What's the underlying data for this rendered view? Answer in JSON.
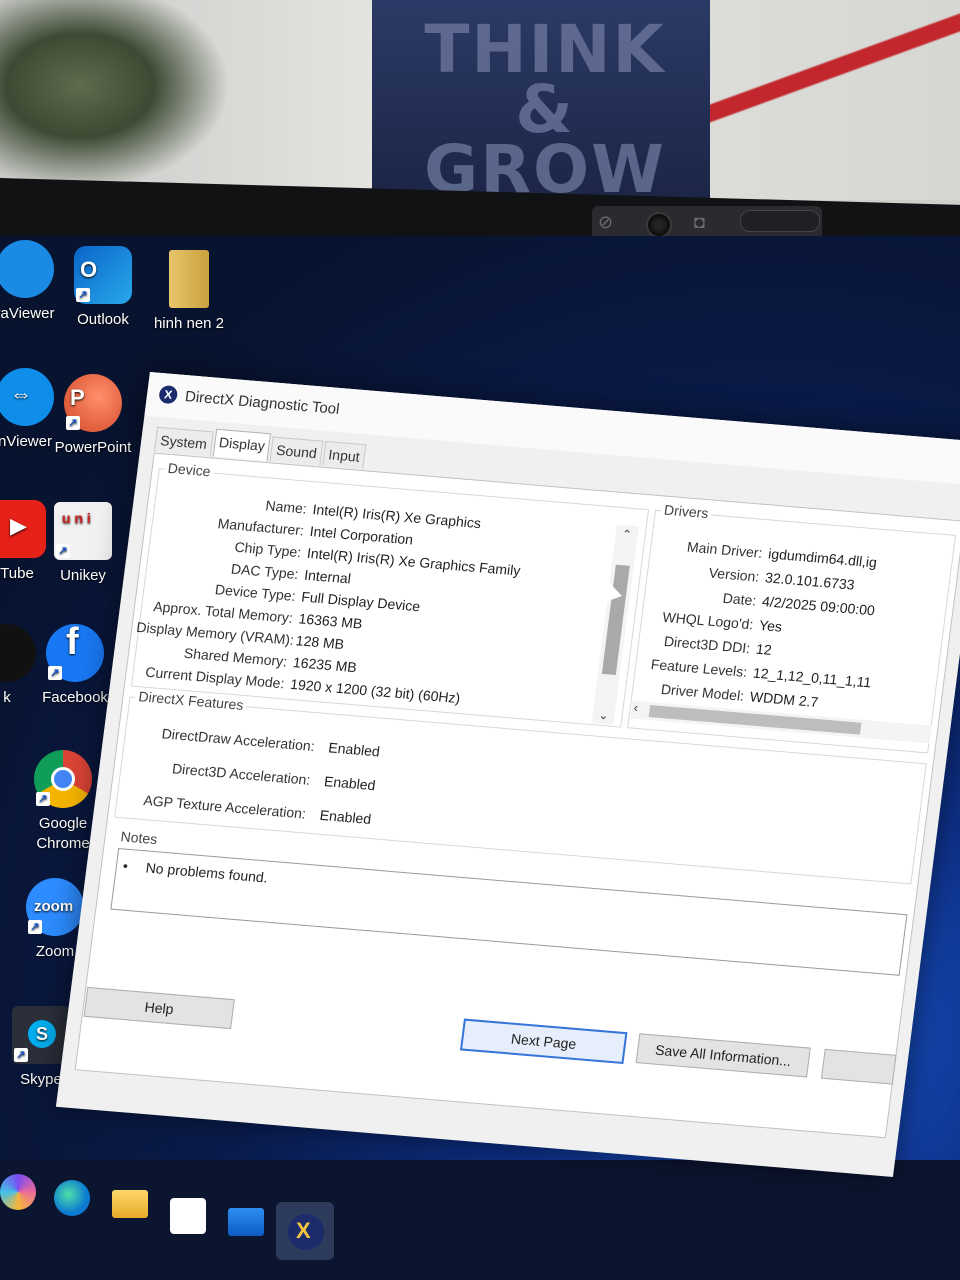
{
  "photo": {
    "poster_text": "THINK & GROW RICH"
  },
  "desktop": {
    "icons": [
      {
        "label": "raViewer"
      },
      {
        "label": "Outlook"
      },
      {
        "label": "hinh nen 2"
      },
      {
        "label": "nViewer"
      },
      {
        "label": "PowerPoint"
      },
      {
        "label": "Tube"
      },
      {
        "label": "Unikey"
      },
      {
        "label": "k"
      },
      {
        "label": "Facebook"
      },
      {
        "label": "Google Chrome"
      },
      {
        "label": "Zoom"
      },
      {
        "label": "Skype"
      }
    ],
    "zoom_logo_text": "zoom"
  },
  "dialog": {
    "title": "DirectX Diagnostic Tool",
    "tabs": [
      "System",
      "Display",
      "Sound",
      "Input"
    ],
    "active_tab": "Display",
    "device": {
      "group_label": "Device",
      "rows": [
        {
          "k": "Name:",
          "v": "Intel(R) Iris(R) Xe Graphics"
        },
        {
          "k": "Manufacturer:",
          "v": "Intel Corporation"
        },
        {
          "k": "Chip Type:",
          "v": "Intel(R) Iris(R) Xe Graphics Family"
        },
        {
          "k": "DAC Type:",
          "v": "Internal"
        },
        {
          "k": "Device Type:",
          "v": "Full Display Device"
        },
        {
          "k": "Approx. Total Memory:",
          "v": "16363 MB"
        },
        {
          "k": "Display Memory (VRAM):",
          "v": "128 MB"
        },
        {
          "k": "Shared Memory:",
          "v": "16235 MB"
        },
        {
          "k": "Current Display Mode:",
          "v": "1920 x 1200 (32 bit) (60Hz)"
        }
      ]
    },
    "drivers": {
      "group_label": "Drivers",
      "rows": [
        {
          "k": "Main Driver:",
          "v": "igdumdim64.dll,ig"
        },
        {
          "k": "Version:",
          "v": "32.0.101.6733"
        },
        {
          "k": "Date:",
          "v": "4/2/2025 09:00:00"
        },
        {
          "k": "WHQL Logo'd:",
          "v": "Yes"
        },
        {
          "k": "Direct3D DDI:",
          "v": "12"
        },
        {
          "k": "Feature Levels:",
          "v": "12_1,12_0,11_1,11"
        },
        {
          "k": "Driver Model:",
          "v": "WDDM 2.7"
        }
      ]
    },
    "features": {
      "group_label": "DirectX Features",
      "rows": [
        {
          "k": "DirectDraw Acceleration:",
          "v": "Enabled"
        },
        {
          "k": "Direct3D Acceleration:",
          "v": "Enabled"
        },
        {
          "k": "AGP Texture Acceleration:",
          "v": "Enabled"
        }
      ]
    },
    "notes": {
      "group_label": "Notes",
      "items": [
        "No problems found."
      ]
    },
    "buttons": {
      "help": "Help",
      "next_page": "Next Page",
      "save_all": "Save All Information..."
    }
  }
}
